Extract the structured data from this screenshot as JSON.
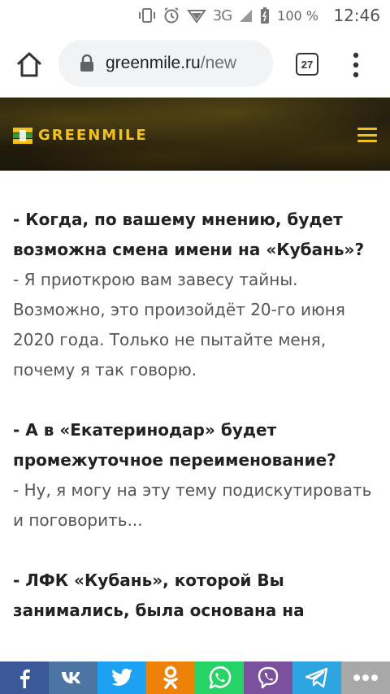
{
  "status_bar": {
    "network": "3G",
    "battery": "100 %",
    "time": "12:46"
  },
  "browser": {
    "url_domain": "greenmile.ru",
    "url_path": "/new",
    "tab_count": "27"
  },
  "site": {
    "logo_text": "GREENMILE",
    "accent_color": "#f2c21b"
  },
  "article": {
    "q1": "- Когда, по вашему мнению, будет возможна смена имени на «Кубань»?",
    "a1": "- Я приоткрою вам завесу тайны. Возможно, это произойдёт 20-го июня 2020 года. Только не пытайте меня, почему я так говорю.",
    "q2": "- А в «Екатеринодар» будет промежуточное переименование?",
    "a2": "- Ну, я могу на эту тему подискутировать и поговорить...",
    "q3": "- ЛФК «Кубань», которой Вы занимались, была основана на"
  },
  "share_bar": [
    {
      "name": "facebook",
      "icon": "facebook-icon",
      "color": "#3b5998"
    },
    {
      "name": "vkontakte",
      "icon": "vk-icon",
      "color": "#4c75a3"
    },
    {
      "name": "twitter",
      "icon": "twitter-icon",
      "color": "#1da1f2"
    },
    {
      "name": "odnoklassniki",
      "icon": "ok-icon",
      "color": "#ee8208"
    },
    {
      "name": "whatsapp",
      "icon": "whatsapp-icon",
      "color": "#25d366"
    },
    {
      "name": "viber",
      "icon": "viber-icon",
      "color": "#7b519d"
    },
    {
      "name": "telegram",
      "icon": "telegram-icon",
      "color": "#2ca5e0"
    },
    {
      "name": "more",
      "icon": "more-icon",
      "color": "#a8a8a8"
    }
  ]
}
